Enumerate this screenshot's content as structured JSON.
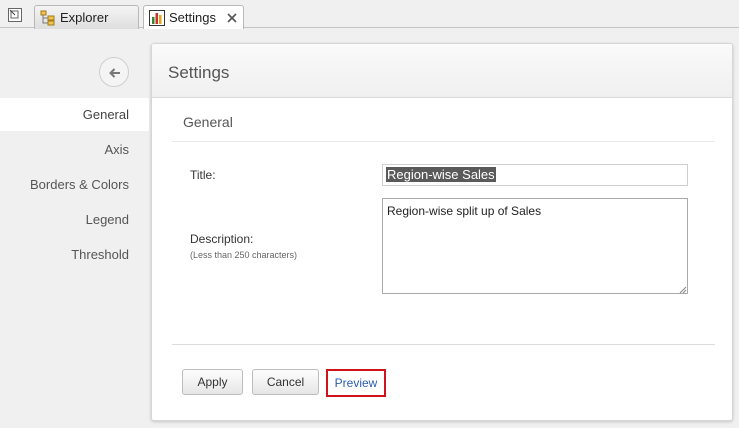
{
  "tabs": [
    {
      "label": "Explorer",
      "icon": "explorer-tree-icon",
      "active": false
    },
    {
      "label": "Settings",
      "icon": "bar-chart-icon",
      "active": true
    }
  ],
  "nav": {
    "back_icon": "arrow-left-icon",
    "items": [
      {
        "label": "General",
        "active": true
      },
      {
        "label": "Axis",
        "active": false
      },
      {
        "label": "Borders & Colors",
        "active": false
      },
      {
        "label": "Legend",
        "active": false
      },
      {
        "label": "Threshold",
        "active": false
      }
    ]
  },
  "panel": {
    "title": "Settings",
    "section": "General",
    "title_label": "Title:",
    "title_value": "Region-wise Sales",
    "description_label": "Description:",
    "description_hint": "(Less than 250 characters)",
    "description_value": "Region-wise split up of Sales"
  },
  "buttons": {
    "apply": "Apply",
    "cancel": "Cancel",
    "preview": "Preview"
  },
  "colors": {
    "preview_highlight": "#d0121c",
    "preview_link": "#2a5db0",
    "selection": "#5a5a5a"
  }
}
